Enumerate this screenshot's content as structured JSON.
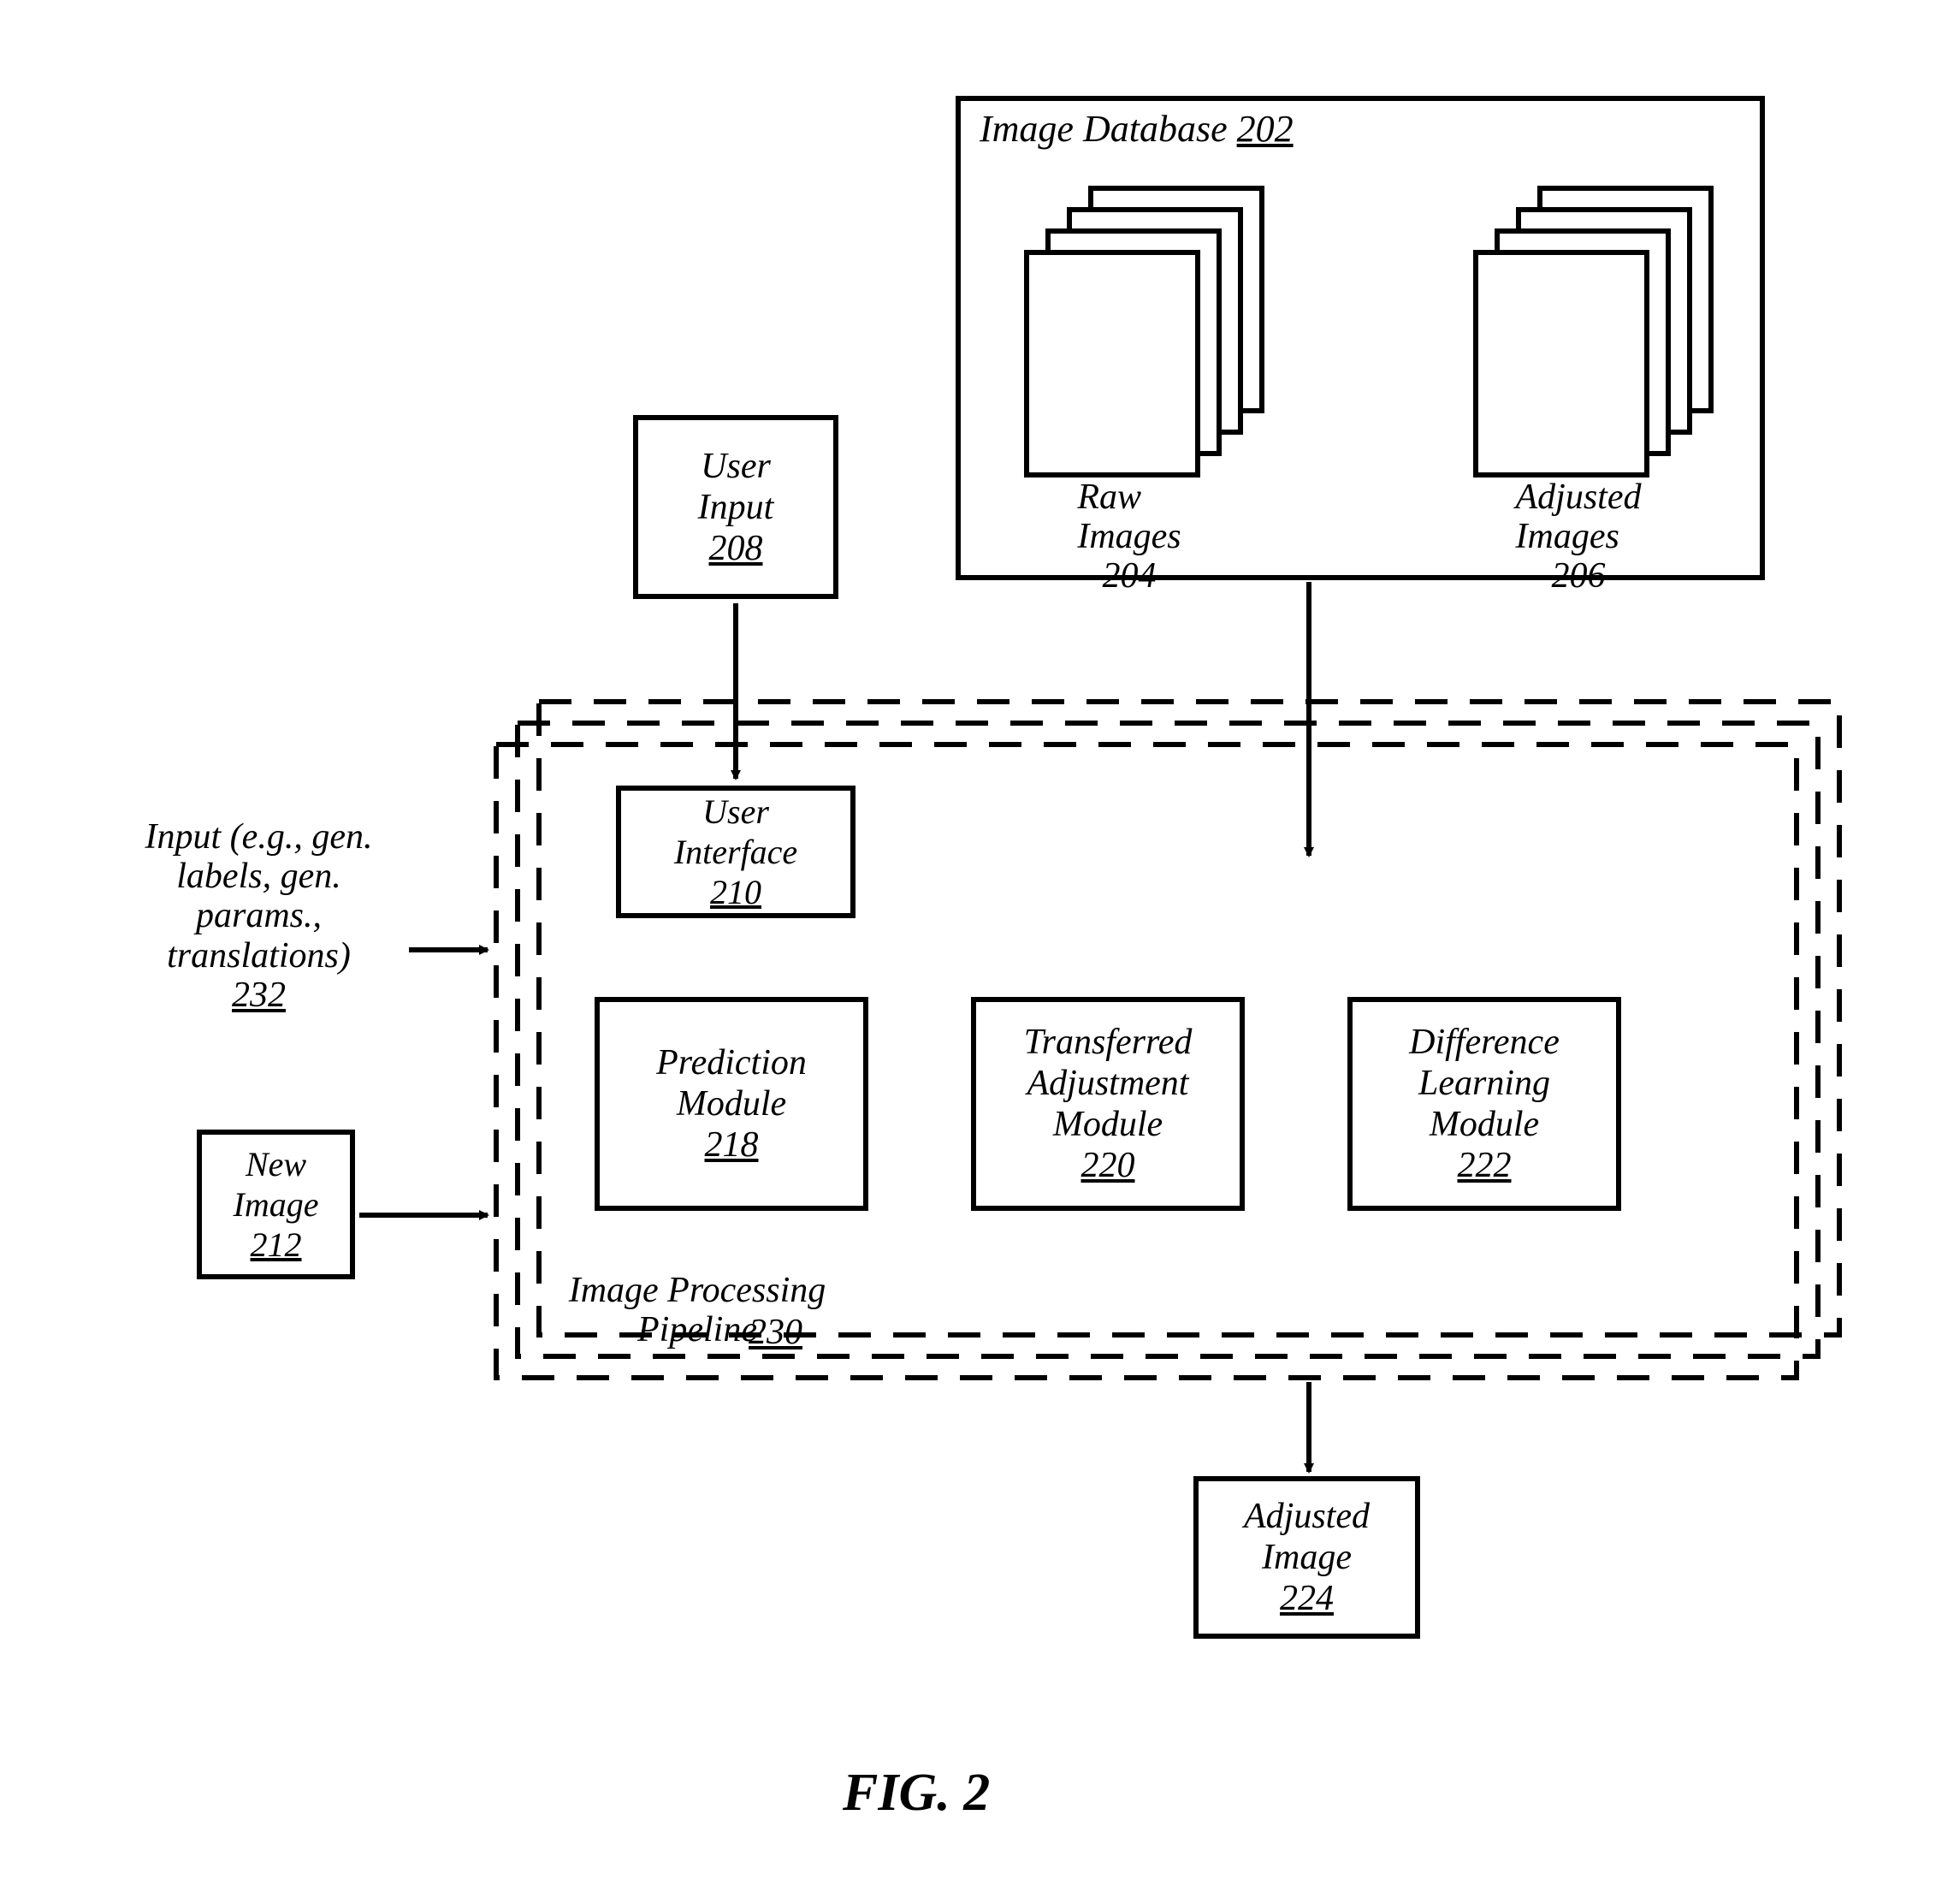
{
  "figure": {
    "caption": "FIG. 2"
  },
  "db": {
    "title": "Image Database",
    "num": "202",
    "raw": {
      "label": "Raw\nImages",
      "num": "204"
    },
    "adj": {
      "label": "Adjusted\nImages",
      "num": "206"
    }
  },
  "user_input": {
    "label": "User\nInput",
    "num": "208"
  },
  "user_iface": {
    "label": "User\nInterface",
    "num": "210"
  },
  "new_image": {
    "label": "New\nImage",
    "num": "212"
  },
  "prediction": {
    "label": "Prediction\nModule",
    "num": "218"
  },
  "transferred": {
    "label": "Transferred\nAdjustment\nModule",
    "num": "220"
  },
  "difflearn": {
    "label": "Difference\nLearning\nModule",
    "num": "222"
  },
  "adj_image": {
    "label": "Adjusted\nImage",
    "num": "224"
  },
  "pipeline": {
    "label": "Image Processing\nPipeline",
    "num": "230"
  },
  "side_input": {
    "label": "Input (e.g., gen.\nlabels, gen.\nparams.,\ntranslations)",
    "num": "232"
  }
}
